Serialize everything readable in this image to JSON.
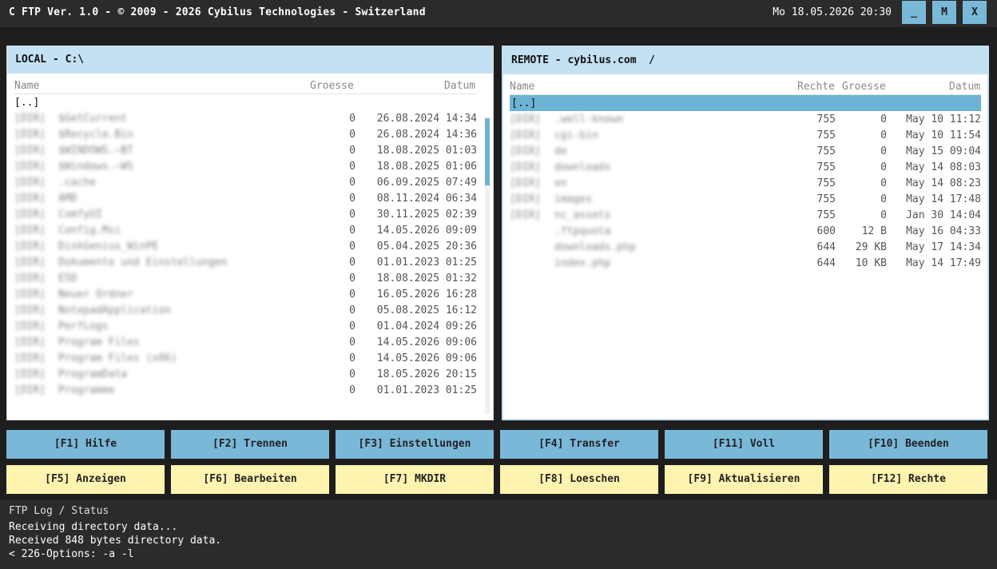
{
  "titlebar": {
    "title": "C FTP Ver. 1.0 - © 2009 - 2026 Cybilus Technologies - Switzerland",
    "datetime": "Mo 18.05.2026  20:30",
    "minimize_label": "_",
    "maximize_label": "M",
    "close_label": "X"
  },
  "local": {
    "header": "LOCAL - C:\\",
    "columns": {
      "name": "Name",
      "size": "Groesse",
      "date": "Datum"
    },
    "up": "[..]",
    "rows": [
      {
        "type": "[DIR]",
        "name": "$GetCurrent",
        "size": "0",
        "date": "26.08.2024 14:34"
      },
      {
        "type": "[DIR]",
        "name": "$Recycle.Bin",
        "size": "0",
        "date": "26.08.2024 14:36"
      },
      {
        "type": "[DIR]",
        "name": "$WINDOWS.~BT",
        "size": "0",
        "date": "18.08.2025 01:03"
      },
      {
        "type": "[DIR]",
        "name": "$Windows.~WS",
        "size": "0",
        "date": "18.08.2025 01:06"
      },
      {
        "type": "[DIR]",
        "name": ".cache",
        "size": "0",
        "date": "06.09.2025 07:49"
      },
      {
        "type": "[DIR]",
        "name": "AMD",
        "size": "0",
        "date": "08.11.2024 06:34"
      },
      {
        "type": "[DIR]",
        "name": "ComfyUI",
        "size": "0",
        "date": "30.11.2025 02:39"
      },
      {
        "type": "[DIR]",
        "name": "Config.Msi",
        "size": "0",
        "date": "14.05.2026 09:09"
      },
      {
        "type": "[DIR]",
        "name": "DiskGenius_WinPE",
        "size": "0",
        "date": "05.04.2025 20:36"
      },
      {
        "type": "[DIR]",
        "name": "Dokumente und Einstellungen",
        "size": "0",
        "date": "01.01.2023 01:25"
      },
      {
        "type": "[DIR]",
        "name": "ESD",
        "size": "0",
        "date": "18.08.2025 01:32"
      },
      {
        "type": "[DIR]",
        "name": "Neuer Ordner",
        "size": "0",
        "date": "16.05.2026 16:28"
      },
      {
        "type": "[DIR]",
        "name": "NotepadApplication",
        "size": "0",
        "date": "05.08.2025 16:12"
      },
      {
        "type": "[DIR]",
        "name": "PerfLogs",
        "size": "0",
        "date": "01.04.2024 09:26"
      },
      {
        "type": "[DIR]",
        "name": "Program Files",
        "size": "0",
        "date": "14.05.2026 09:06"
      },
      {
        "type": "[DIR]",
        "name": "Program Files (x86)",
        "size": "0",
        "date": "14.05.2026 09:06"
      },
      {
        "type": "[DIR]",
        "name": "ProgramData",
        "size": "0",
        "date": "18.05.2026 20:15"
      },
      {
        "type": "[DIR]",
        "name": "Programme",
        "size": "0",
        "date": "01.01.2023 01:25"
      }
    ]
  },
  "remote": {
    "header": "REMOTE - cybilus.com  /",
    "columns": {
      "name": "Name",
      "rights": "Rechte",
      "size": "Groesse",
      "date": "Datum"
    },
    "up": "[..]",
    "rows": [
      {
        "type": "[DIR]",
        "name": ".well-known",
        "rights": "755",
        "size": "0",
        "date": "May 10 11:12"
      },
      {
        "type": "[DIR]",
        "name": "cgi-bin",
        "rights": "755",
        "size": "0",
        "date": "May 10 11:54"
      },
      {
        "type": "[DIR]",
        "name": "de",
        "rights": "755",
        "size": "0",
        "date": "May 15 09:04"
      },
      {
        "type": "[DIR]",
        "name": "downloads",
        "rights": "755",
        "size": "0",
        "date": "May 14 08:03"
      },
      {
        "type": "[DIR]",
        "name": "en",
        "rights": "755",
        "size": "0",
        "date": "May 14 08:23"
      },
      {
        "type": "[DIR]",
        "name": "images",
        "rights": "755",
        "size": "0",
        "date": "May 14 17:48"
      },
      {
        "type": "[DIR]",
        "name": "nc_assets",
        "rights": "755",
        "size": "0",
        "date": "Jan 30 14:04"
      },
      {
        "type": "",
        "name": ".ftpquota",
        "rights": "600",
        "size": "12 B",
        "date": "May 16 04:33"
      },
      {
        "type": "",
        "name": "downloads.php",
        "rights": "644",
        "size": "29 KB",
        "date": "May 17 14:34"
      },
      {
        "type": "",
        "name": "index.php",
        "rights": "644",
        "size": "10 KB",
        "date": "May 14 17:49"
      }
    ]
  },
  "buttons_top": [
    {
      "label": "[F1] Hilfe"
    },
    {
      "label": "[F2] Trennen"
    },
    {
      "label": "[F3] Einstellungen"
    },
    {
      "label": "[F4] Transfer"
    },
    {
      "label": "[F11] Voll"
    },
    {
      "label": "[F10] Beenden"
    }
  ],
  "buttons_bottom": [
    {
      "label": "[F5] Anzeigen"
    },
    {
      "label": "[F6] Bearbeiten"
    },
    {
      "label": "[F7] MKDIR"
    },
    {
      "label": "[F8] Loeschen"
    },
    {
      "label": "[F9] Aktualisieren"
    },
    {
      "label": "[F12] Rechte"
    }
  ],
  "log": {
    "title": "FTP Log / Status",
    "lines": [
      "Receiving directory data...",
      "Received 848 bytes directory data.",
      "< 226-Options: -a -l"
    ]
  },
  "colors": {
    "titlebar_bg": "#2b2b2b",
    "panel_header": "#c4e1f3",
    "accent_blue": "#7ab8d8",
    "selection": "#6cb3d6",
    "button_yellow": "#fff3b0"
  }
}
